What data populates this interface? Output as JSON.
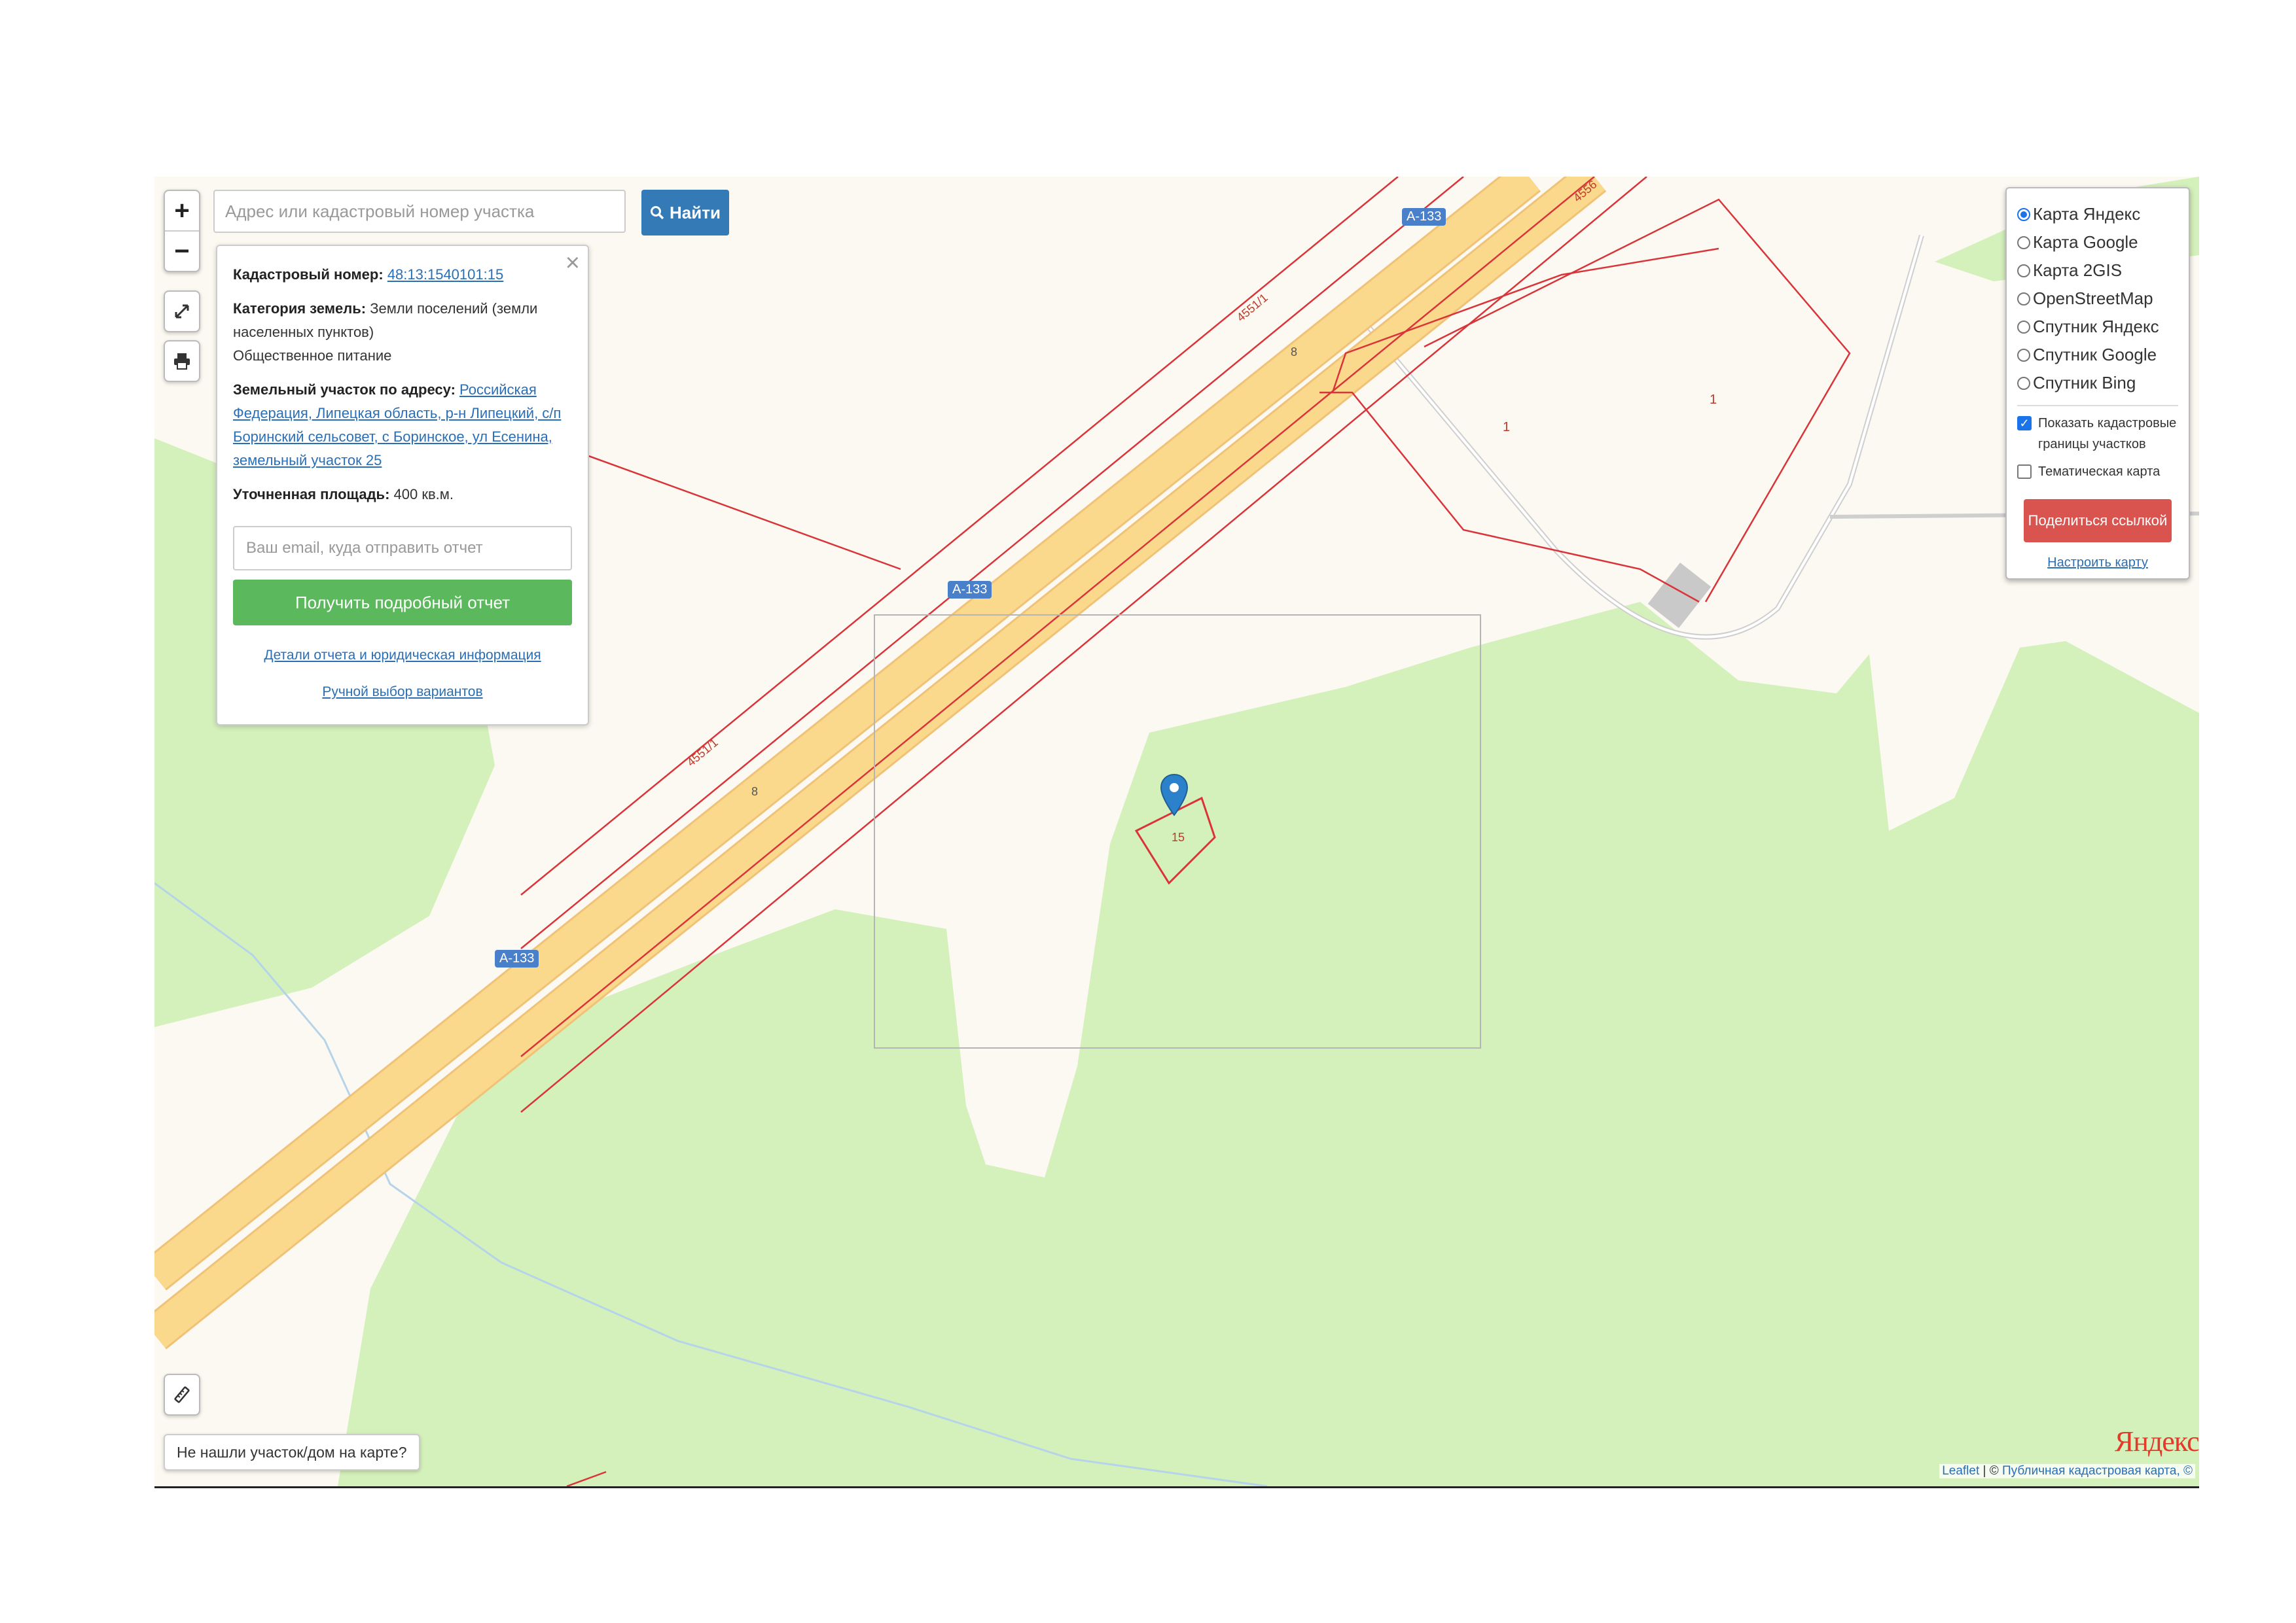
{
  "search": {
    "placeholder": "Адрес или кадастровый номер участка",
    "button_label": "Найти"
  },
  "zoom": {
    "in_label": "+",
    "out_label": "−"
  },
  "info_panel": {
    "cadastral_label": "Кадастровый номер:",
    "cadastral_value": "48:13:1540101:15",
    "category_label": "Категория земель:",
    "category_value": "Земли поселений (земли населенных пунктов)",
    "use_value": "Общественное питание",
    "address_label": "Земельный участок по адресу:",
    "address_value": "Российская Федерация, Липецкая область, р-н Липецкий, с/п Боринский сельсовет, с Боринское, ул Есенина, земельный участок 25",
    "area_label": "Уточненная площадь:",
    "area_value": "400 кв.м.",
    "email_placeholder": "Ваш email, куда отправить отчет",
    "report_button": "Получить подробный отчет",
    "details_link": "Детали отчета и юридическая информация",
    "manual_link": "Ручной выбор вариантов"
  },
  "layers": {
    "options": [
      {
        "label": "Карта Яндекс",
        "selected": true
      },
      {
        "label": "Карта Google",
        "selected": false
      },
      {
        "label": "Карта 2GIS",
        "selected": false
      },
      {
        "label": "OpenStreetMap",
        "selected": false
      },
      {
        "label": "Спутник Яндекс",
        "selected": false
      },
      {
        "label": "Спутник Google",
        "selected": false
      },
      {
        "label": "Спутник Bing",
        "selected": false
      }
    ],
    "show_borders_label": "Показать кадастровые границы участков",
    "show_borders_checked": true,
    "thematic_label": "Тематическая карта",
    "thematic_checked": false,
    "share_button": "Поделиться ссылкой",
    "configure_link": "Настроить карту"
  },
  "map_labels": {
    "road_badges": [
      "А-133",
      "А-133",
      "А-133"
    ],
    "parcel_1": "1",
    "parcel_1b": "1",
    "parcel_15": "15",
    "road_parcel_a": "4551/1",
    "road_parcel_b": "4551/1",
    "road_parcel_c": "4556",
    "lane_8a": "8",
    "lane_8b": "8"
  },
  "not_found_button": "Не нашли участок/дом на карте?",
  "yandex_logo": "Яндекс",
  "attribution": {
    "leaflet": "Leaflet",
    "separator": " | © ",
    "source": "Публичная кадастровая карта, ©"
  },
  "colors": {
    "forest": "#d4f0bb",
    "ground": "#fbf9f1",
    "road": "#fad98c",
    "cadastral_border": "#d9343a",
    "badge": "#4a7fc9",
    "marker": "#2b82cb"
  },
  "icons": [
    "zoom-in-icon",
    "zoom-out-icon",
    "fullscreen-icon",
    "print-icon",
    "ruler-icon",
    "search-icon",
    "close-icon",
    "map-marker-icon"
  ]
}
